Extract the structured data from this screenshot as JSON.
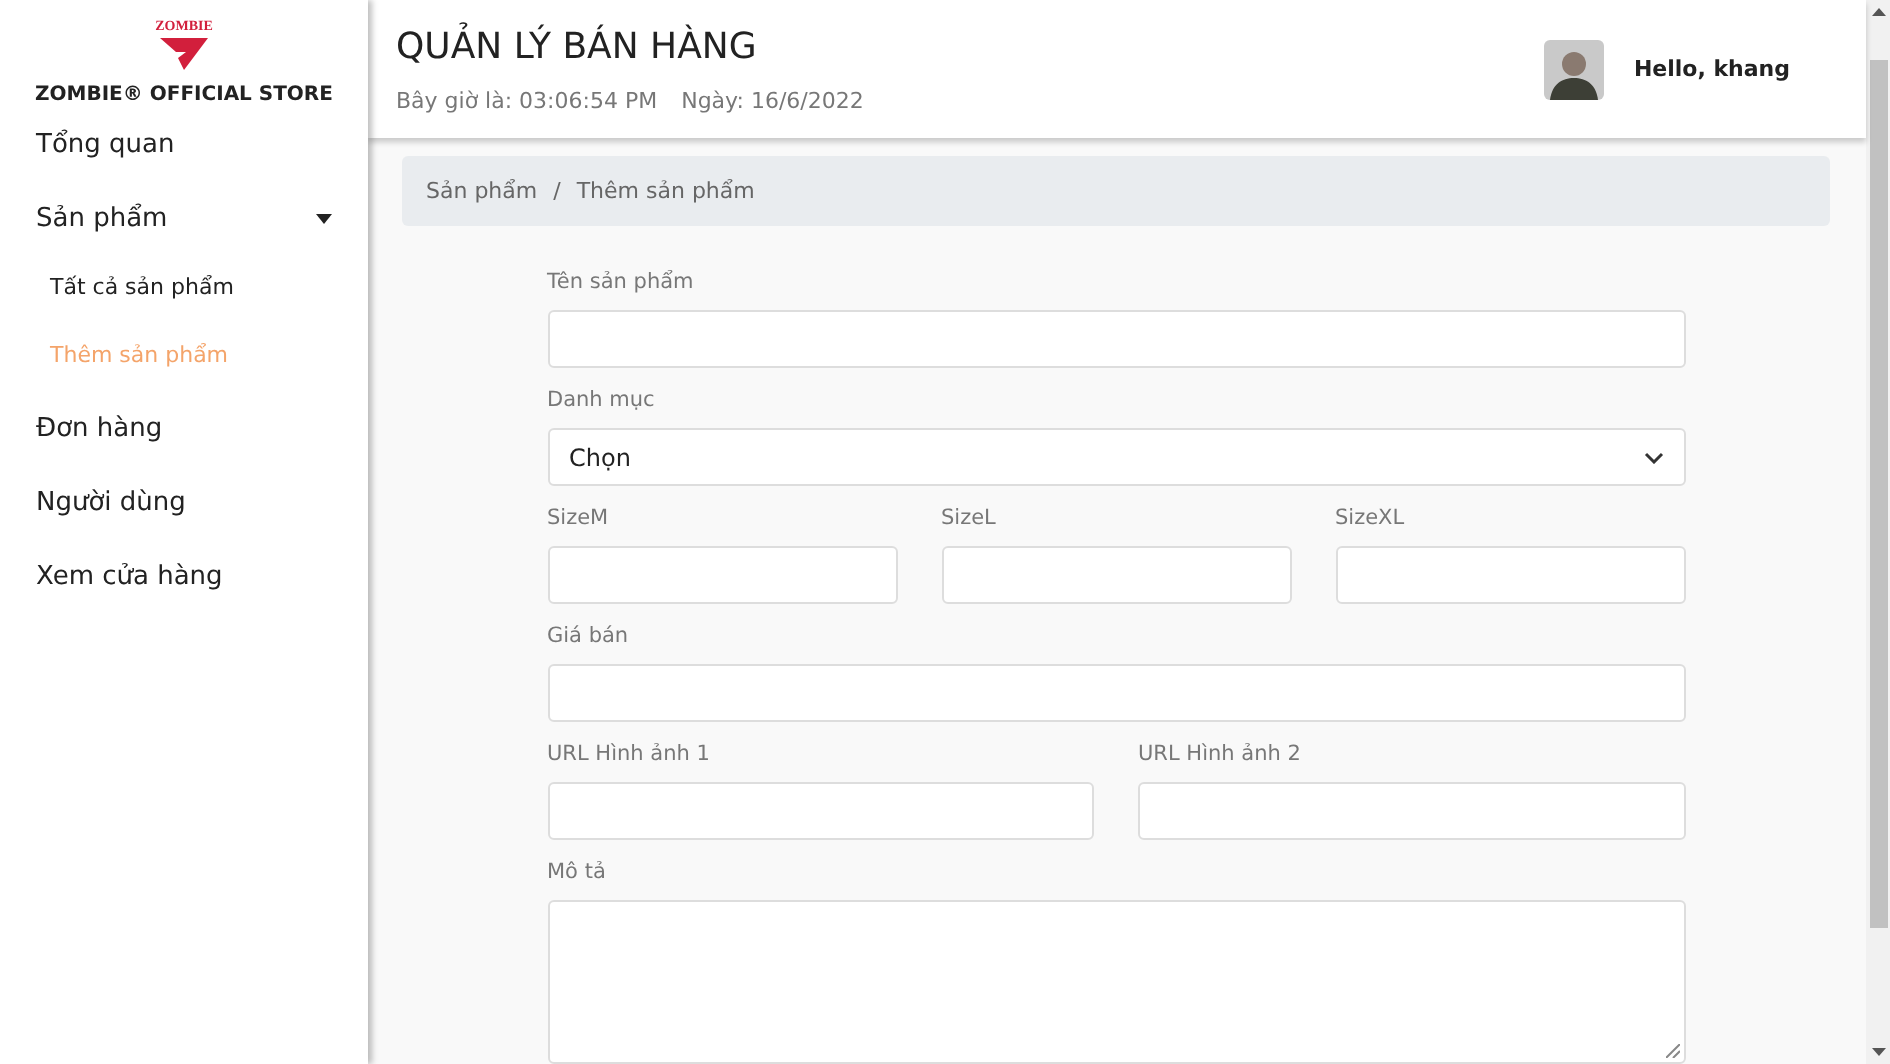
{
  "sidebar": {
    "logo_text": "ZOMBIE",
    "store_name": "ZOMBIE® OFFICIAL STORE",
    "items": [
      {
        "kind": "item",
        "label": "Tổng quan",
        "selected": false
      },
      {
        "kind": "item",
        "label": "Sản phẩm",
        "selected": false,
        "expanded": true,
        "children": [
          {
            "label": "Tất cả sản phẩm",
            "selected": false
          },
          {
            "label": "Thêm sản phẩm",
            "selected": true
          }
        ]
      },
      {
        "kind": "item",
        "label": "Đơn hàng",
        "selected": false
      },
      {
        "kind": "item",
        "label": "Người dùng",
        "selected": false
      },
      {
        "kind": "item",
        "label": "Xem cửa hàng",
        "selected": false
      }
    ]
  },
  "header": {
    "title": "QUẢN LÝ BÁN HÀNG",
    "time": "Bây giờ là: 03:06:54 PM",
    "date": "Ngày: 16/6/2022",
    "greeting": "Hello, khang"
  },
  "breadcrumb": {
    "separator": "/",
    "items": [
      "Sản phẩm",
      "Thêm sản phẩm"
    ]
  },
  "form": {
    "rows": [
      [
        {
          "kind": "input",
          "label": "Tên sản phẩm"
        }
      ],
      [
        {
          "kind": "select",
          "label": "Danh mục",
          "value": "Chọn"
        }
      ],
      [
        {
          "kind": "input",
          "label": "SizeM"
        },
        {
          "kind": "input",
          "label": "SizeL"
        },
        {
          "kind": "input",
          "label": "SizeXL"
        }
      ],
      [
        {
          "kind": "input",
          "label": "Giá bán"
        }
      ],
      [
        {
          "kind": "input",
          "label": "URL Hình ảnh 1"
        },
        {
          "kind": "input",
          "label": "URL Hình ảnh 2"
        }
      ],
      [
        {
          "kind": "textarea",
          "label": "Mô tả"
        }
      ]
    ]
  }
}
